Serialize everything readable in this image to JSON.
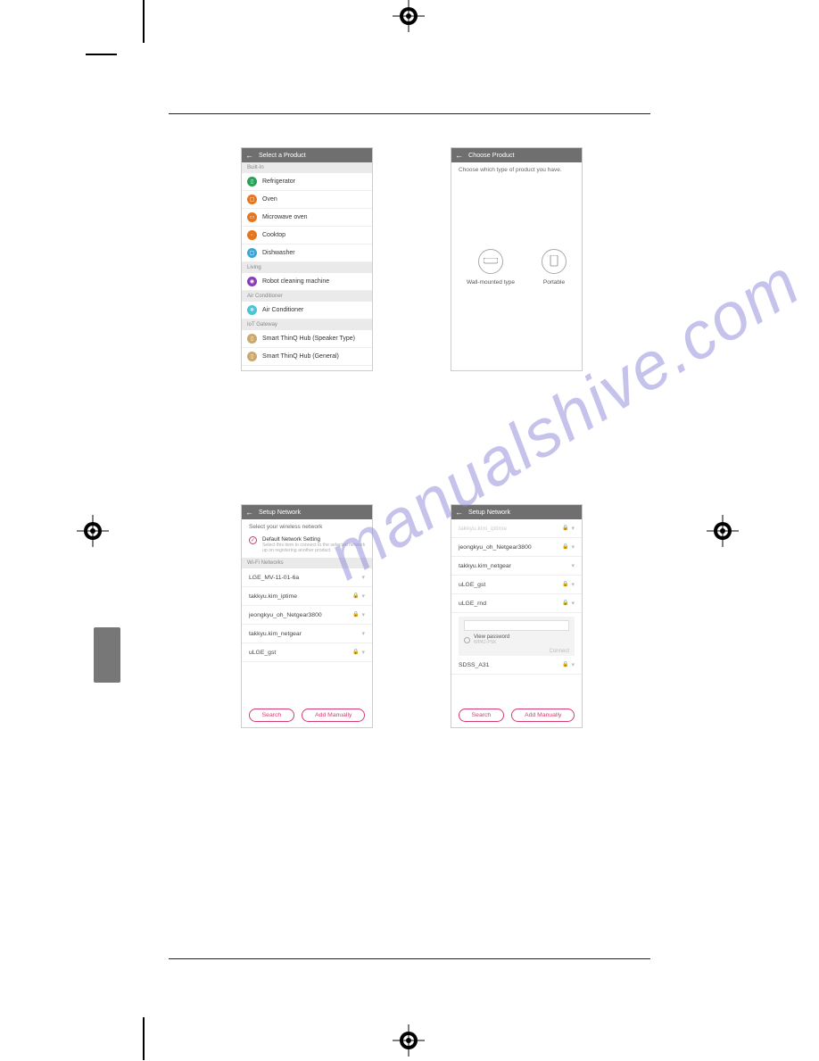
{
  "watermark": "manualshive.com",
  "screen1": {
    "title": "Select a Product",
    "categories": {
      "builtin": "Built-In",
      "living": "Living",
      "ac": "Air Conditioner",
      "iot": "IoT Gateway"
    },
    "items": {
      "refrigerator": "Refrigerator",
      "oven": "Oven",
      "microwave": "Microwave oven",
      "cooktop": "Cooktop",
      "dishwasher": "Dishwasher",
      "robot": "Robot cleaning machine",
      "ac": "Air Conditioner",
      "hub_speaker": "Smart ThinQ Hub (Speaker Type)",
      "hub_general": "Smart ThinQ Hub (General)"
    }
  },
  "screen2": {
    "title": "Choose Product",
    "instruction": "Choose which type of product you have.",
    "types": {
      "wall": "Wall-mounted type",
      "portable": "Portable"
    }
  },
  "screen3": {
    "title": "Setup Network",
    "select_label": "Select your wireless network",
    "default_title": "Default Network Setting",
    "default_sub": "Select this item to connect to the selected network up on registering another product",
    "wifi_header": "Wi-Fi Networks",
    "networks": [
      "LGE_MV-11-01-6a",
      "takkyu.kim_iptime",
      "jeongkyu_oh_Netgear3800",
      "takkyu.kim_netgear",
      "uLGE_gst"
    ],
    "buttons": {
      "search": "Search",
      "add": "Add Manually"
    }
  },
  "screen4": {
    "title": "Setup Network",
    "top_cut": "takkyu.kim_iptime",
    "networks": [
      "jeongkyu_oh_Netgear3800",
      "takkyu.kim_netgear",
      "uLGE_gst",
      "uLGE_rnd"
    ],
    "view_password": "View password",
    "security": "WPA2-PSK",
    "connect": "Connect",
    "bottom_net": "SDSS_A31",
    "buttons": {
      "search": "Search",
      "add": "Add Manually"
    }
  }
}
